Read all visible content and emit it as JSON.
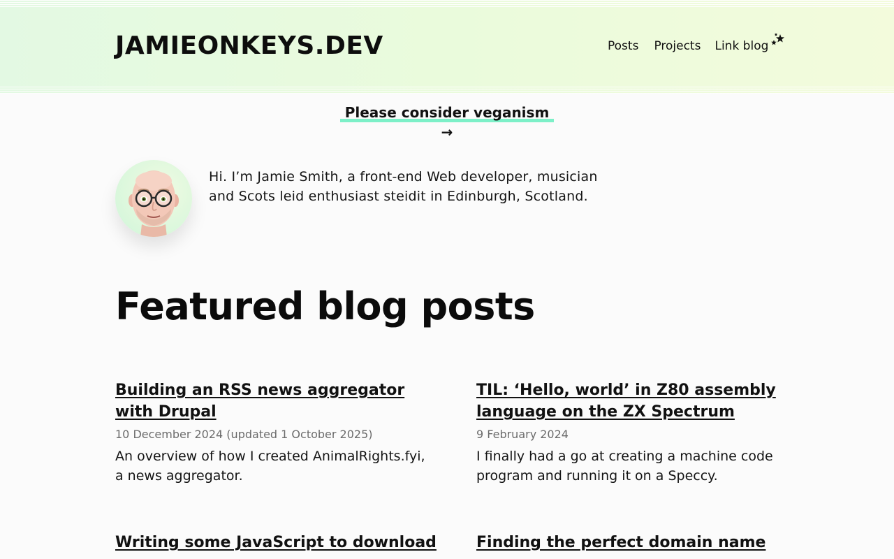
{
  "header": {
    "site_title": "JAMIEONKEYS.DEV",
    "nav": {
      "posts": "Posts",
      "projects": "Projects",
      "link_blog": "Link blog"
    },
    "accent_gradient": [
      "#e3f9e3",
      "#f3fbdc"
    ]
  },
  "banner": {
    "label": "Please consider veganism →",
    "underline_color": "#7df0c8"
  },
  "intro": {
    "text": "Hi. I’m Jamie Smith, a front-end Web developer, musician and Scots leid enthusiast steidit in Edinburgh, Scotland."
  },
  "featured": {
    "heading": "Featured blog posts",
    "posts": [
      {
        "title": "Building an RSS news aggregator with Drupal",
        "date": "10 December 2024 (updated 1 October 2025)",
        "description": "An overview of how I created AnimalRights.fyi, a news aggregator."
      },
      {
        "title": "TIL: ‘Hello, world’ in Z80 assembly language on the ZX Spectrum",
        "date": "9 February 2024",
        "description": "I finally had a go at creating a machine code program and running it on a Speccy."
      },
      {
        "title": "Writing some JavaScript to download"
      },
      {
        "title": "Finding the perfect domain name"
      }
    ]
  },
  "icons": {
    "nav_stars": "sparkle-stars-icon",
    "avatar": "memoji-avatar"
  }
}
